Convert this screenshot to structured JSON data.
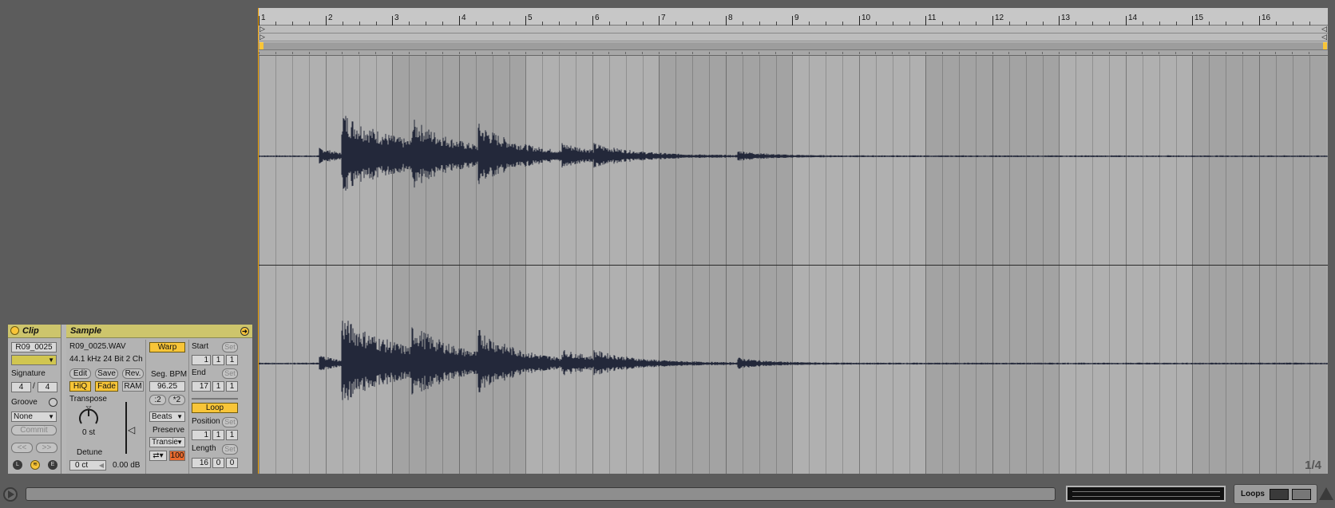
{
  "clip": {
    "header": "Clip",
    "name": "R09_0025",
    "signature_label": "Signature",
    "signature_num": "4",
    "signature_sep": "/",
    "signature_den": "4",
    "groove_label": "Groove",
    "groove_value": "None",
    "commit_label": "Commit",
    "nudge_left": "<<",
    "nudge_right": ">>",
    "bottom_buttons": [
      "L",
      "",
      "E"
    ]
  },
  "sample": {
    "header": "Sample",
    "filename": "R09_0025.WAV",
    "format": "44.1 kHz 24 Bit 2 Ch",
    "buttons": [
      "Edit",
      "Save",
      "Rev."
    ],
    "toggles": [
      "HiQ",
      "Fade",
      "RAM"
    ],
    "transpose_label": "Transpose",
    "transpose_value": "0 st",
    "detune_label": "Detune",
    "detune_value": "0 ct",
    "gain_value": "0.00 dB",
    "warp_label": "Warp",
    "seg_bpm_label": "Seg. BPM",
    "seg_bpm_value": "96.25",
    "half_label": ":2",
    "double_label": "*2",
    "warp_mode": "Beats",
    "preserve_label": "Preserve",
    "preserve_value": "Transie",
    "loop_mode_icon": "⇄▾",
    "envelope_value": "100",
    "start_label": "Start",
    "set_label": "Set",
    "start_values": [
      "1",
      "1",
      "1"
    ],
    "end_label": "End",
    "end_values": [
      "17",
      "1",
      "1"
    ],
    "loop_label": "Loop",
    "position_label": "Position",
    "position_values": [
      "1",
      "1",
      "1"
    ],
    "length_label": "Length",
    "length_values": [
      "16",
      "0",
      "0"
    ]
  },
  "editor": {
    "bars": [
      "1",
      "2",
      "3",
      "4",
      "5",
      "6",
      "7",
      "8",
      "9",
      "10",
      "11",
      "12",
      "13",
      "14",
      "15",
      "16"
    ],
    "zoom_text": "1/4"
  },
  "statusbar": {
    "loops_label": "Loops"
  },
  "colors": {
    "accent": "#f8c538",
    "panel_head": "#cdc56c",
    "envelope_red": "#e86a2e",
    "wave": "#23283a"
  }
}
